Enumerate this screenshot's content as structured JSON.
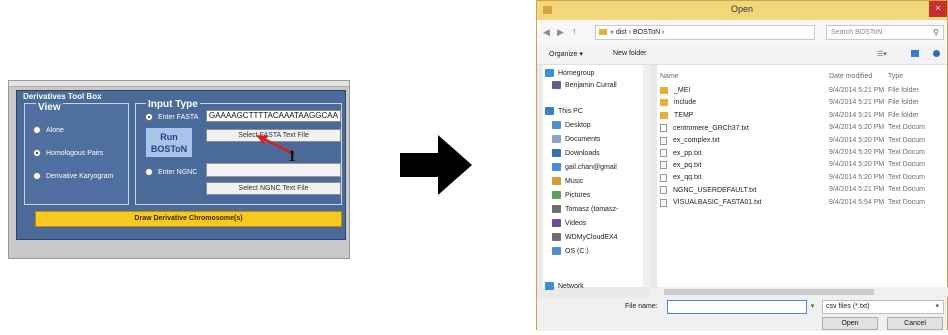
{
  "toolbox": {
    "title": "Derivatives Tool Box",
    "view": {
      "label": "View",
      "options": [
        "Alone",
        "Homologous Pairs",
        "Derivative Karyogram"
      ],
      "selected_index": 1
    },
    "input_type": {
      "label": "Input Type",
      "fasta_option": "Enter FASTA",
      "fasta_value": "GAAAAGCTTTTACAAATAAGGCAA",
      "run_button": [
        "Run",
        "BOSToN"
      ],
      "select_fasta_button": "Select FASTA Text File",
      "ngnc_option": "Enter NGNC",
      "select_ngnc_button": "Select NGNC Text File"
    },
    "draw_button": "Draw Derivative Chromosome(s)",
    "annotation_number": "1"
  },
  "dialog": {
    "title": "Open",
    "close_glyph": "×",
    "breadcrumb": "« dist › BOSToN ›",
    "search_placeholder": "Search BOSToN",
    "organize": "Organize ▾",
    "new_folder": "New folder",
    "nav": [
      {
        "label": "Homegroup",
        "icon": "homegroup-icon",
        "color": "#3a8fd6"
      },
      {
        "label": "Benjamin Currall",
        "icon": "user-icon",
        "color": "#6d5a8f"
      },
      {
        "label": "This PC",
        "icon": "computer-icon",
        "color": "#3d7fc4"
      },
      {
        "label": "Desktop",
        "icon": "desktop-icon",
        "color": "#4f8fd0"
      },
      {
        "label": "Documents",
        "icon": "documents-icon",
        "color": "#8aa6c8"
      },
      {
        "label": "Downloads",
        "icon": "downloads-icon",
        "color": "#3b6fb3"
      },
      {
        "label": "gail.chan@gmail",
        "icon": "user-folder-icon",
        "color": "#4a8ad6"
      },
      {
        "label": "Music",
        "icon": "music-icon",
        "color": "#d39b3a"
      },
      {
        "label": "Pictures",
        "icon": "pictures-icon",
        "color": "#5ea15a"
      },
      {
        "label": "Tomasz (tomasz-",
        "icon": "network-user-icon",
        "color": "#6d6d6d"
      },
      {
        "label": "Videos",
        "icon": "videos-icon",
        "color": "#6b4a9a"
      },
      {
        "label": "WDMyCloudEX4",
        "icon": "network-drive-icon",
        "color": "#6d6d6d"
      },
      {
        "label": "OS (C:)",
        "icon": "drive-icon",
        "color": "#4d8dd0"
      },
      {
        "label": "Network",
        "icon": "network-icon",
        "color": "#3a8fd6"
      }
    ],
    "columns": {
      "name": "Name",
      "date": "Date modified",
      "type": "Type"
    },
    "files": [
      {
        "name": "_MEI",
        "date": "9/4/2014 5:21 PM",
        "type": "File folder",
        "kind": "folder"
      },
      {
        "name": "include",
        "date": "9/4/2014 5:21 PM",
        "type": "File folder",
        "kind": "folder"
      },
      {
        "name": "TEMP",
        "date": "9/4/2014 5:21 PM",
        "type": "File folder",
        "kind": "folder"
      },
      {
        "name": "centromere_GRCh37.txt",
        "date": "9/4/2014 5:20 PM",
        "type": "Text Docum",
        "kind": "file"
      },
      {
        "name": "ex_complex.txt",
        "date": "9/4/2014 5:20 PM",
        "type": "Text Docum",
        "kind": "file"
      },
      {
        "name": "ex_pp.txt",
        "date": "9/4/2014 5:20 PM",
        "type": "Text Docum",
        "kind": "file"
      },
      {
        "name": "ex_pq.txt",
        "date": "9/4/2014 5:20 PM",
        "type": "Text Docum",
        "kind": "file"
      },
      {
        "name": "ex_qq.txt",
        "date": "9/4/2014 5:20 PM",
        "type": "Text Docum",
        "kind": "file"
      },
      {
        "name": "NGNC_USERDEFAULT.txt",
        "date": "9/4/2014 5:21 PM",
        "type": "Text Docum",
        "kind": "file"
      },
      {
        "name": "VISUALBASIC_FASTA01.txt",
        "date": "9/4/2014 5:54 PM",
        "type": "Text Docum",
        "kind": "file"
      }
    ],
    "file_name_label": "File name:",
    "file_name_value": "",
    "file_type": "csv files (*.txt)",
    "open_button": "Open",
    "cancel_button": "Cancel"
  }
}
